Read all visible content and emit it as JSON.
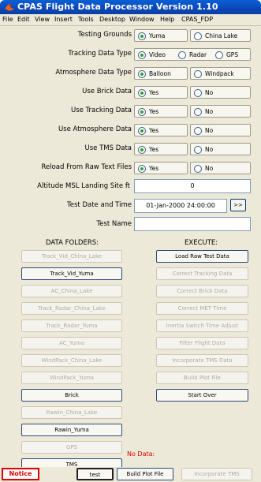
{
  "window": {
    "title": "CPAS Flight Data Processor Version 1.10"
  },
  "menu": [
    "File",
    "Edit",
    "View",
    "Insert",
    "Tools",
    "Desktop",
    "Window",
    "Help",
    "CPAS_FDP"
  ],
  "fields": {
    "testing_grounds": {
      "label": "Testing Grounds",
      "options": [
        "Yuma",
        "China Lake"
      ],
      "selected": "Yuma"
    },
    "tracking_data_type": {
      "label": "Tracking Data Type",
      "options": [
        "Video",
        "Radar",
        "GPS"
      ],
      "selected": "Video"
    },
    "atmosphere_data_type": {
      "label": "Atmosphere Data Type",
      "options": [
        "Balloon",
        "Windpack"
      ],
      "selected": "Balloon"
    },
    "use_brick_data": {
      "label": "Use Brick Data",
      "options": [
        "Yes",
        "No"
      ],
      "selected": "Yes"
    },
    "use_tracking_data": {
      "label": "Use Tracking Data",
      "options": [
        "Yes",
        "No"
      ],
      "selected": "Yes"
    },
    "use_atmosphere_data": {
      "label": "Use Atmosphere Data",
      "options": [
        "Yes",
        "No"
      ],
      "selected": "Yes"
    },
    "use_tms_data": {
      "label": "Use TMS Data",
      "options": [
        "Yes",
        "No"
      ],
      "selected": "Yes"
    },
    "reload_raw": {
      "label": "Reload From Raw Text Files",
      "options": [
        "Yes",
        "No"
      ],
      "selected": "Yes"
    },
    "altitude_msl": {
      "label": "Altitude MSL Landing Site ft",
      "value": "0"
    },
    "test_date": {
      "label": "Test Date and Time",
      "value": "01-Jan-2000 24:00:00",
      "button": ">>"
    },
    "test_name": {
      "label": "Test Name",
      "value": ""
    }
  },
  "data_folders": {
    "title": "DATA FOLDERS:",
    "items": [
      {
        "label": "Track_Vid_China_Lake",
        "enabled": false
      },
      {
        "label": "Track_Vid_Yuma",
        "enabled": true
      },
      {
        "label": "AC_China_Lake",
        "enabled": false
      },
      {
        "label": "Track_Radar_China_Lake",
        "enabled": false
      },
      {
        "label": "Track_Radar_Yuma",
        "enabled": false
      },
      {
        "label": "AC_Yuma",
        "enabled": false
      },
      {
        "label": "WindPack_China_Lake",
        "enabled": false
      },
      {
        "label": "WindPack_Yuma",
        "enabled": false
      },
      {
        "label": "Brick",
        "enabled": true
      },
      {
        "label": "Rawin_China_Lake",
        "enabled": false
      },
      {
        "label": "Rawin_Yuma",
        "enabled": true
      },
      {
        "label": "GPS",
        "enabled": false
      },
      {
        "label": "TMS",
        "enabled": true
      }
    ]
  },
  "execute": {
    "title": "EXECUTE:",
    "items": [
      {
        "label": "Load Raw Test Data",
        "enabled": true
      },
      {
        "label": "Correct Tracking Data",
        "enabled": false
      },
      {
        "label": "Correct Brick Data",
        "enabled": false
      },
      {
        "label": "Correct MET Time",
        "enabled": false
      },
      {
        "label": "Inertia Switch Time Adjust",
        "enabled": false
      },
      {
        "label": "Filter Flight Data",
        "enabled": false
      },
      {
        "label": "Incorporate TMS Data",
        "enabled": false
      },
      {
        "label": "Build Plot File",
        "enabled": false
      },
      {
        "label": "Start Over",
        "enabled": true
      }
    ]
  },
  "status": {
    "no_data": "No Data:"
  },
  "bottom": {
    "notice": "Notice",
    "test": "test",
    "build_plot_file": "Build Plot File",
    "incorporate_tms": "Incorporate TMS"
  },
  "colors": {
    "title_bar": "#0b49b8",
    "panel": "#ece9d8",
    "selected_dot": "#2e9d2e",
    "alert": "#e00000"
  }
}
